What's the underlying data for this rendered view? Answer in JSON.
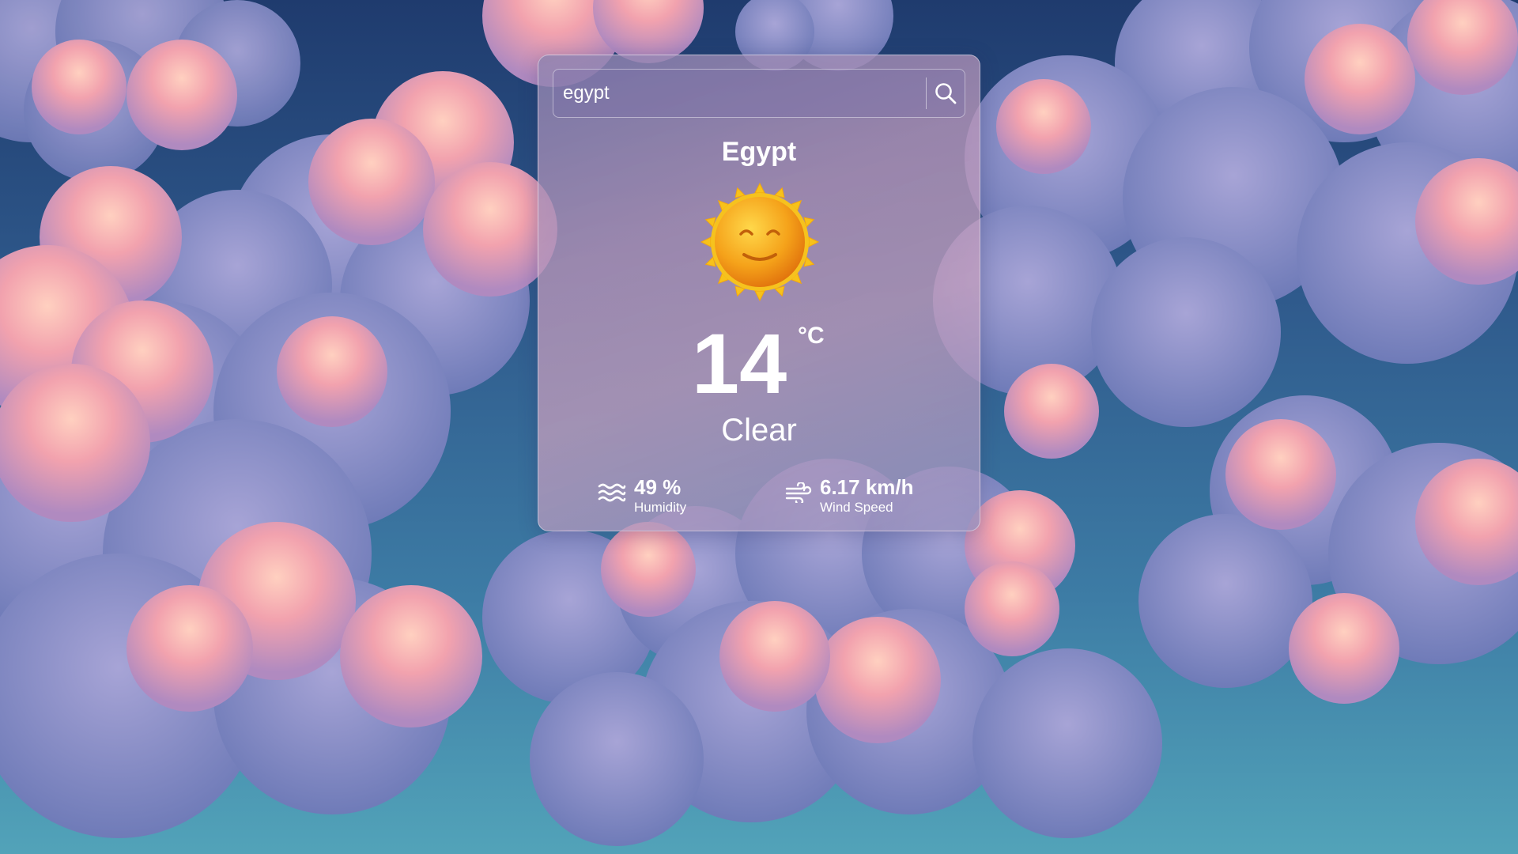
{
  "search": {
    "value": "egypt",
    "icon": "search-icon"
  },
  "weather": {
    "city": "Egypt",
    "icon": "sun-icon",
    "temperature": "14",
    "unit": "°C",
    "condition": "Clear"
  },
  "stats": {
    "humidity": {
      "icon": "humidity-waves-icon",
      "value": "49 %",
      "label": "Humidity"
    },
    "wind": {
      "icon": "wind-icon",
      "value": "6.17 km/h",
      "label": "Wind Speed"
    }
  },
  "colors": {
    "sky_top": "#1f3b6e",
    "sky_bottom": "#52a3b9",
    "cloud_pink": "#f0a0a8",
    "cloud_lavender": "#8b8fc8",
    "sun_orange": "#f5a623",
    "text": "#ffffff"
  }
}
